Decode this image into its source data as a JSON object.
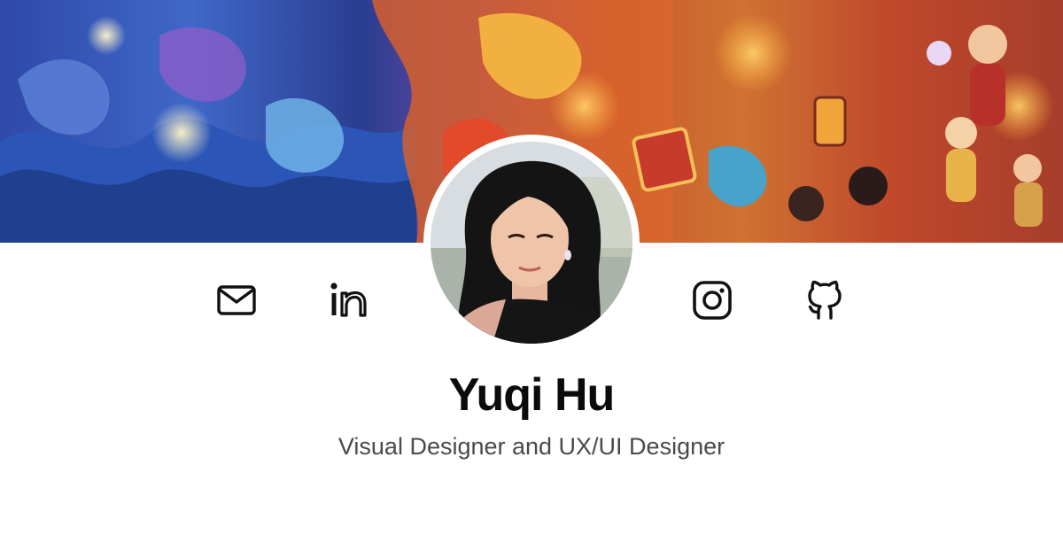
{
  "profile": {
    "name": "Yuqi Hu",
    "subtitle": "Visual Designer and UX/UI Designer"
  },
  "social_links": [
    {
      "icon": "mail-icon",
      "label": "Email"
    },
    {
      "icon": "linkedin-icon",
      "label": "LinkedIn"
    },
    {
      "icon": "instagram-icon",
      "label": "Instagram"
    },
    {
      "icon": "github-icon",
      "label": "GitHub"
    }
  ],
  "banner": {
    "description_icon": "illustrated-festival-banner",
    "colors": [
      "#2f49a8",
      "#3f68c9",
      "#d9722c",
      "#e9a23b",
      "#c6452c"
    ]
  },
  "theme": {
    "text": "#0b0b0b",
    "subtext": "#4a4a4a",
    "background": "#ffffff"
  }
}
